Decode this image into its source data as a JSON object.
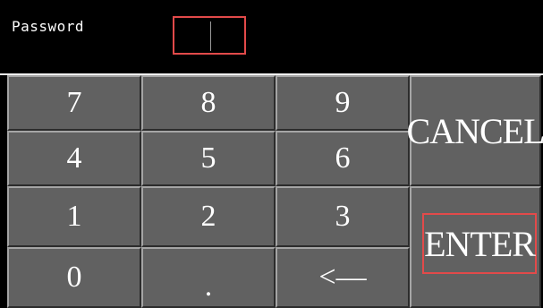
{
  "header": {
    "password_label": "Password",
    "password_value": "",
    "password_placeholder": ""
  },
  "keypad": {
    "keys": [
      "7",
      "8",
      "9",
      "4",
      "5",
      "6",
      "1",
      "2",
      "3",
      "0",
      ".",
      "<—"
    ],
    "cancel_label": "CANCEL",
    "enter_label": "ENTER"
  },
  "colors": {
    "background": "#000000",
    "key_face": "#616161",
    "highlight": "#e24a4a",
    "text": "#ffffff"
  }
}
